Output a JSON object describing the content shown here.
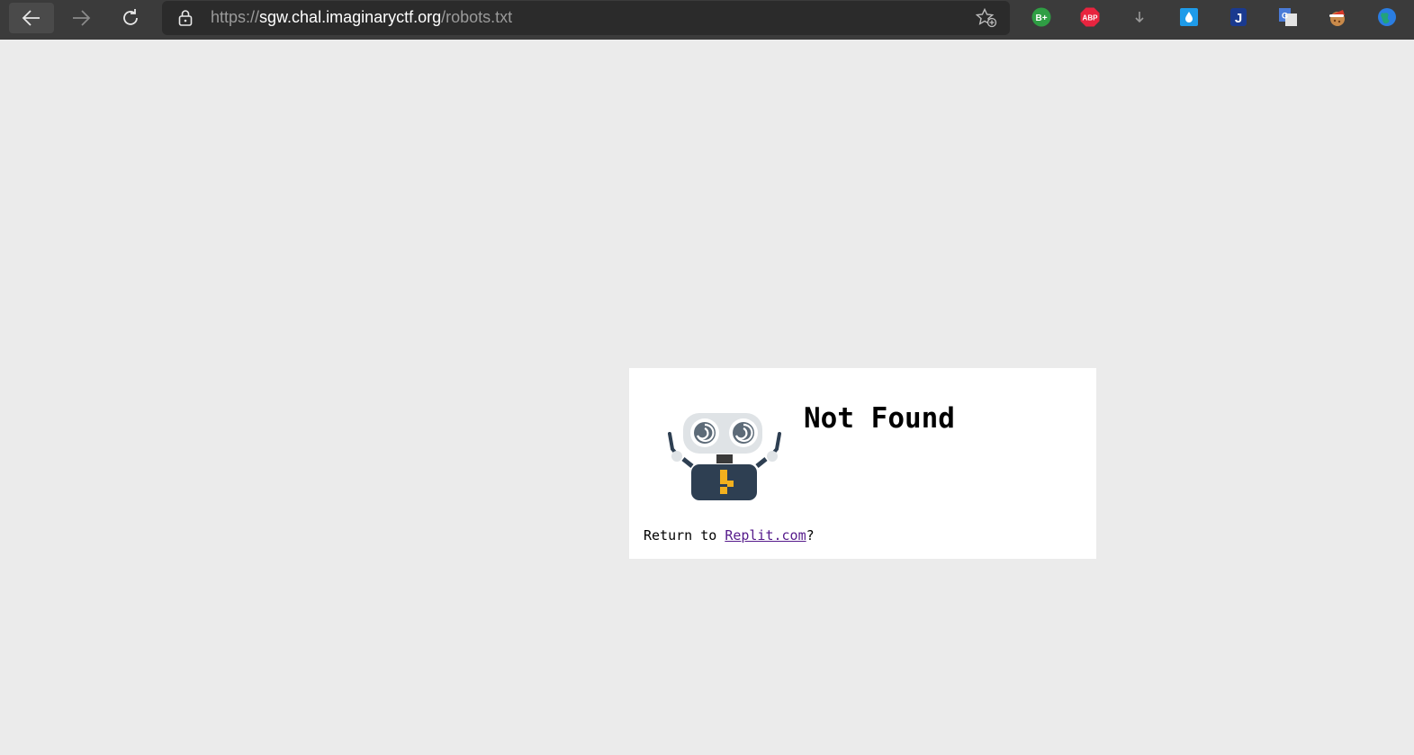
{
  "browser": {
    "url_scheme": "https://",
    "url_host": "sgw.chal.imaginaryctf.org",
    "url_path": "/robots.txt",
    "extensions": [
      {
        "name": "better-twitch-icon",
        "label": "B+",
        "color": "#2f9e44"
      },
      {
        "name": "adblock-plus-icon",
        "label": "ABP",
        "color": "#e8243f"
      },
      {
        "name": "download-icon",
        "label": "",
        "color": "#9a9a9a"
      },
      {
        "name": "raindrop-icon",
        "label": "",
        "color": "#1e9be9"
      },
      {
        "name": "j-extension-icon",
        "label": "J",
        "color": "#1a3a8f"
      },
      {
        "name": "google-translate-icon",
        "label": "G",
        "color": "#4a7bd8"
      },
      {
        "name": "cookie-santa-icon",
        "label": "",
        "color": "#d93b2b"
      },
      {
        "name": "globe-icon",
        "label": "",
        "color": "#2a7de1"
      }
    ]
  },
  "page": {
    "heading": "Not Found",
    "return_prefix": "Return to ",
    "return_link": "Replit.com",
    "return_suffix": "?"
  },
  "colors": {
    "page_bg": "#ebebeb",
    "card_bg": "#ffffff",
    "link": "#551a8b",
    "toolbar": "#3b3b3b"
  }
}
